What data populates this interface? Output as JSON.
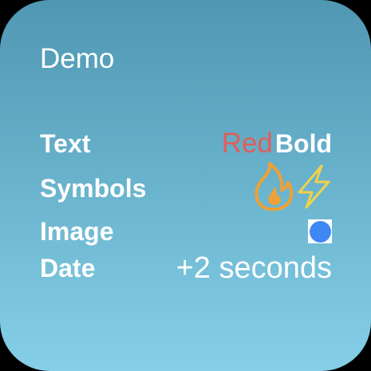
{
  "widget": {
    "title": "Demo",
    "colors": {
      "gradient_top": "#4f97b2",
      "gradient_bottom": "#85cfe8",
      "text": "#ffffff",
      "red": "#e35d57",
      "flame": "#f0a133",
      "bolt": "#f2d24a",
      "image_dot": "#3f87f5"
    },
    "rows": {
      "text": {
        "label": "Text",
        "red_value": "Red",
        "bold_value": "Bold"
      },
      "symbols": {
        "label": "Symbols",
        "icons": [
          "flame-icon",
          "bolt-icon"
        ]
      },
      "image": {
        "label": "Image",
        "icon": "blue-circle-image"
      },
      "date": {
        "label": "Date",
        "value": "+2 seconds"
      }
    }
  }
}
